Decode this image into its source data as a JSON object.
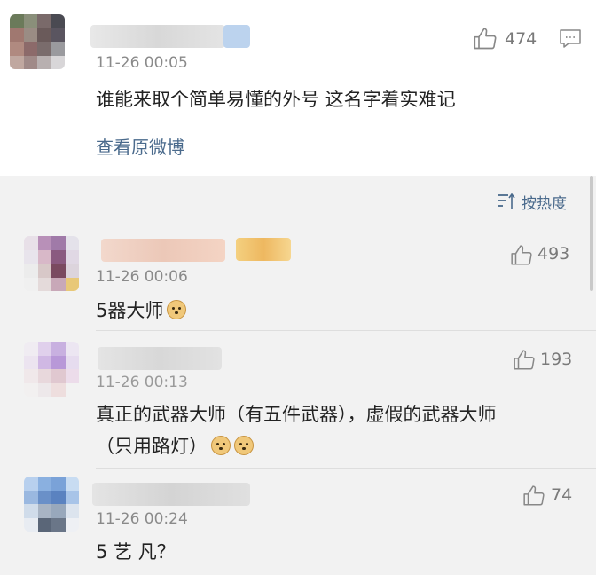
{
  "top_comment": {
    "time": "11-26 00:05",
    "text": "谁能来取个简单易懂的外号 这名字着实难记",
    "likes": "474",
    "link": "查看原微博"
  },
  "sort": {
    "label": "按热度"
  },
  "replies": [
    {
      "time": "11-26 00:06",
      "text": "5器大师",
      "likes": "493",
      "emoji_count": 1
    },
    {
      "time": "11-26 00:13",
      "text_line1": "真正的武器大师（有五件武器），虚假的武器大师",
      "text_line2": "（只用路灯）",
      "likes": "193",
      "emoji_count": 2
    },
    {
      "time": "11-26 00:24",
      "text": "5 艺 凡？",
      "likes": "74"
    }
  ],
  "colors": {
    "link_blue": "#4a6a8c",
    "background": "#f2f2f2",
    "card": "#ffffff"
  }
}
